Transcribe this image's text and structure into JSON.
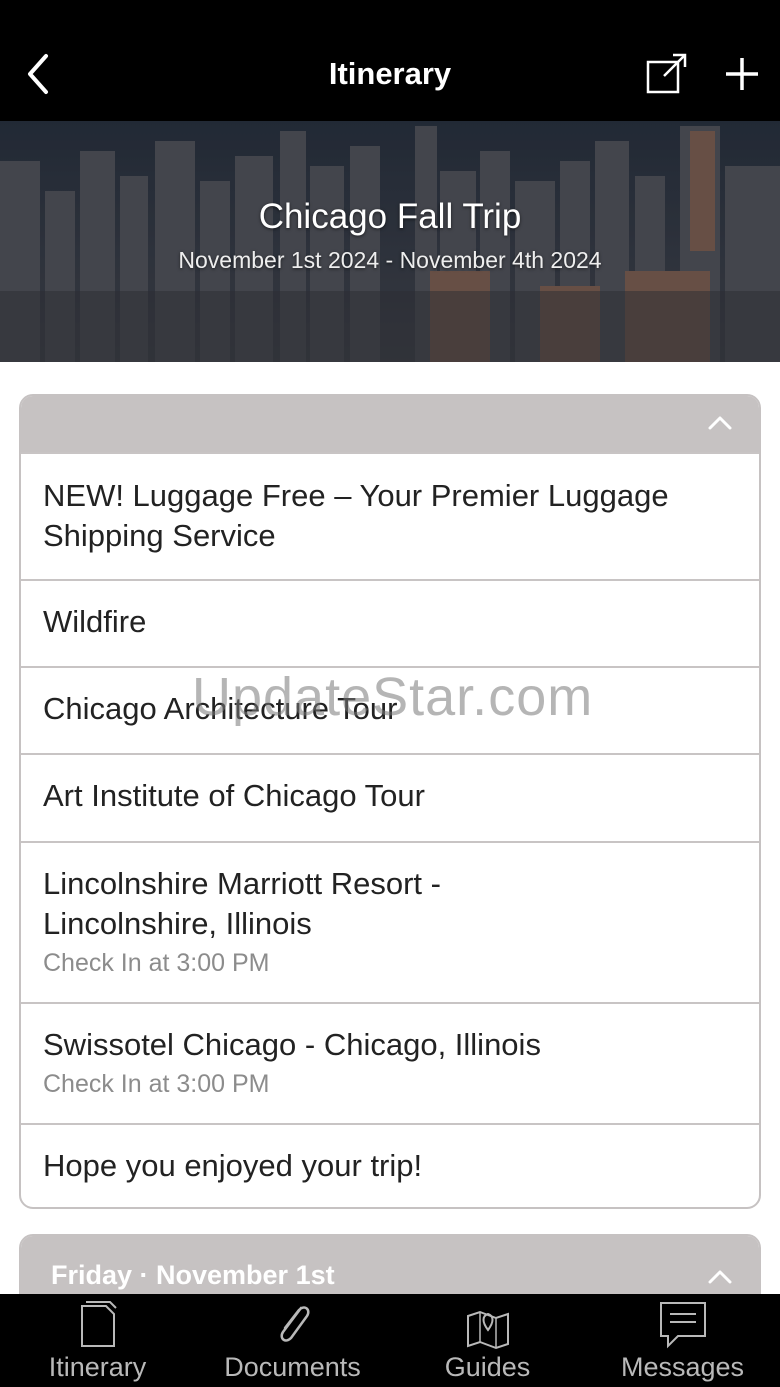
{
  "header": {
    "title": "Itinerary",
    "icons": [
      "chevron-left-icon",
      "share-icon",
      "plus-icon"
    ]
  },
  "hero": {
    "trip_name": "Chicago Fall Trip",
    "dates": "November 1st 2024 - November 4th 2024"
  },
  "overview": {
    "items": [
      {
        "name": "NEW! Luggage Free – Your Premier Luggage Shipping Service",
        "detail": ""
      },
      {
        "name": "Wildfire",
        "detail": ""
      },
      {
        "name": "Chicago Architecture Tour",
        "detail": ""
      },
      {
        "name": "Art Institute of Chicago Tour",
        "detail": ""
      },
      {
        "name": "Lincolnshire Marriott Resort - Lincolnshire, Illinois",
        "detail": "Check In at 3:00 PM"
      },
      {
        "name": "Swissotel Chicago - Chicago, Illinois",
        "detail": "Check In at 3:00 PM"
      },
      {
        "name": "Hope you enjoyed your trip!",
        "detail": ""
      }
    ]
  },
  "day_section": {
    "label": "Friday · November 1st"
  },
  "watermark": "UpdateStar.com",
  "tabbar": {
    "tabs": [
      {
        "label": "Itinerary",
        "icon": "document-icon"
      },
      {
        "label": "Documents",
        "icon": "paperclip-icon"
      },
      {
        "label": "Guides",
        "icon": "map-pin-icon"
      },
      {
        "label": "Messages",
        "icon": "message-icon"
      }
    ]
  },
  "colors": {
    "topbar": "#000000",
    "section_header": "#c6c2c2",
    "tab_label": "#b9b9b9",
    "detail_text": "#8c8c8c"
  }
}
